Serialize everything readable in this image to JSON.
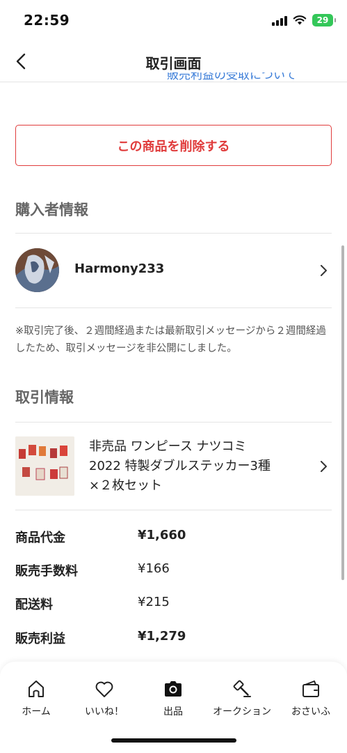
{
  "status_bar": {
    "time": "22:59",
    "battery": "29"
  },
  "nav": {
    "title": "取引画面",
    "cutoff_text": "販売利益の受取について"
  },
  "delete_button": {
    "label": "この商品を削除する"
  },
  "buyer_section": {
    "title": "購入者情報",
    "name": "Harmony233"
  },
  "notice": "※取引完了後、２週間経過または最新取引メッセージから２週間経過したため、取引メッセージを非公開にしました。",
  "trade_section": {
    "title": "取引情報",
    "item": {
      "line1": "非売品 ワンピース ナツコミ",
      "line2": "2022 特製ダブルステッカー3種",
      "line3": "×２枚セット"
    }
  },
  "fees": [
    {
      "label": "商品代金",
      "value": "¥1,660"
    },
    {
      "label": "販売手数料",
      "value": "¥166"
    },
    {
      "label": "配送料",
      "value": "¥215"
    },
    {
      "label": "販売利益",
      "value": "¥1,279"
    }
  ],
  "tabs": [
    {
      "label": "ホーム",
      "icon": "home-icon"
    },
    {
      "label": "いいね！",
      "icon": "heart-icon"
    },
    {
      "label": "出品",
      "icon": "camera-icon"
    },
    {
      "label": "オークション",
      "icon": "gavel-icon"
    },
    {
      "label": "おさいふ",
      "icon": "wallet-icon"
    }
  ],
  "colors": {
    "accent_red": "#e03c3c",
    "link_blue": "#3b7dd8",
    "battery_green": "#34c759"
  }
}
